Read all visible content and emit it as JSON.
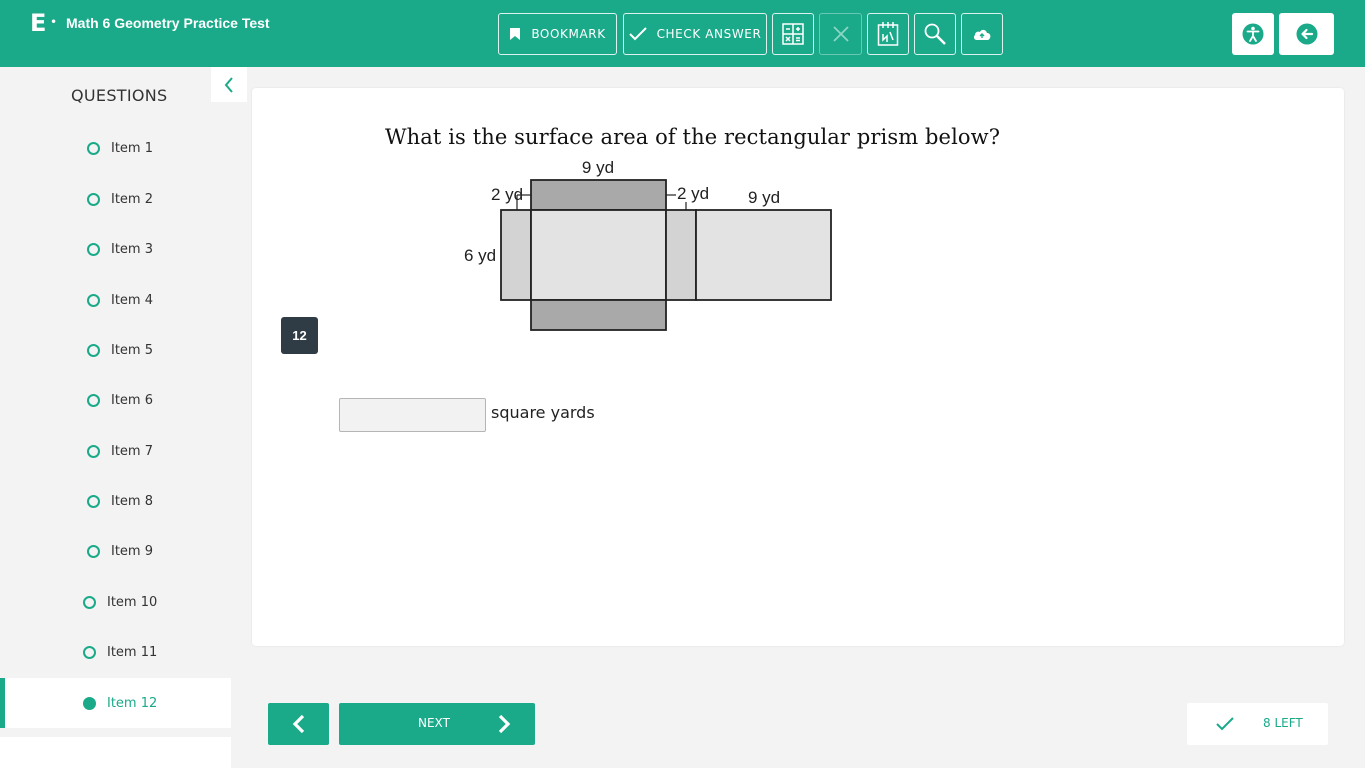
{
  "app": {
    "logo_letter": "E",
    "logo_dot": "•",
    "title": "Math 6 Geometry Practice Test"
  },
  "toolbar": {
    "bookmark_label": "BOOKMARK",
    "check_answer_label": "CHECK ANSWER",
    "icons": [
      "bookmark-icon",
      "check-icon",
      "calculator-icon",
      "close-icon",
      "formula-sheet-icon",
      "magnifier-icon",
      "cloud-save-icon",
      "accessibility-icon",
      "exit-icon"
    ]
  },
  "sidebar": {
    "title": "QUESTIONS",
    "items": [
      {
        "label": "Item 1",
        "active": false
      },
      {
        "label": "Item 2",
        "active": false
      },
      {
        "label": "Item 3",
        "active": false
      },
      {
        "label": "Item 4",
        "active": false
      },
      {
        "label": "Item 5",
        "active": false
      },
      {
        "label": "Item 6",
        "active": false
      },
      {
        "label": "Item 7",
        "active": false
      },
      {
        "label": "Item 8",
        "active": false
      },
      {
        "label": "Item 9",
        "active": false
      },
      {
        "label": "Item 10",
        "active": false
      },
      {
        "label": "Item 11",
        "active": false
      },
      {
        "label": "Item 12",
        "active": true
      }
    ]
  },
  "question": {
    "number": "12",
    "prompt": "What is the surface area of the rectangular prism below?",
    "diagram_labels": {
      "top_length": "9 yd",
      "left_height": "2 yd",
      "right_height": "2 yd",
      "right_length": "9 yd",
      "side_height": "6 yd"
    },
    "answer_value": "",
    "answer_placeholder": "",
    "unit_label": "square yards"
  },
  "footer": {
    "next_label": "NEXT",
    "remaining_label": "8 LEFT"
  },
  "colors": {
    "brand": "#1aaa8a",
    "dark_badge": "#2f3c46",
    "face_dark": "#a9a9a9",
    "face_mid": "#d3d3d3",
    "face_light": "#e3e3e3"
  }
}
